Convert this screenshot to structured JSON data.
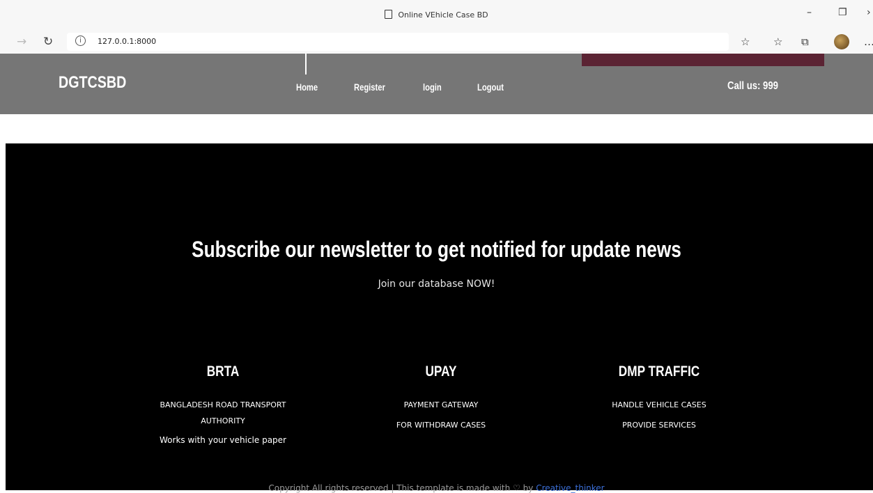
{
  "browser": {
    "tab_title": "Online VEhicle Case BD",
    "url": "127.0.0.1:8000",
    "window_controls": [
      "minimize-icon",
      "restore-icon",
      "close-icon"
    ]
  },
  "header": {
    "brand": "DGTCSBD",
    "nav": [
      {
        "label": "Home"
      },
      {
        "label": "Register"
      },
      {
        "label": "login"
      },
      {
        "label": "Logout"
      }
    ],
    "call": "Call us: 999",
    "colors": {
      "background": "#767676",
      "accent": "#5b2333"
    }
  },
  "newsletter": {
    "title": "Subscribe our newsletter to get notified for update news",
    "subtitle": "Join our database NOW!"
  },
  "columns": [
    {
      "title": "BRTA",
      "lines": [
        "BANGLADESH ROAD TRANSPORT",
        "AUTHORITY",
        "Works with your vehicle paper"
      ]
    },
    {
      "title": "UPAY",
      "lines": [
        "PAYMENT GATEWAY",
        "FOR WITHDRAW CASES"
      ]
    },
    {
      "title": "DMP TRAFFIC",
      "lines": [
        "HANDLE VEHICLE CASES",
        "PROVIDE SERVICES"
      ]
    }
  ],
  "footer": {
    "copyright_text": "Copyright All rights reserved | This template is made with",
    "heart_icon": "♡",
    "by_text": "by",
    "author_link": "Creative_thinker"
  }
}
